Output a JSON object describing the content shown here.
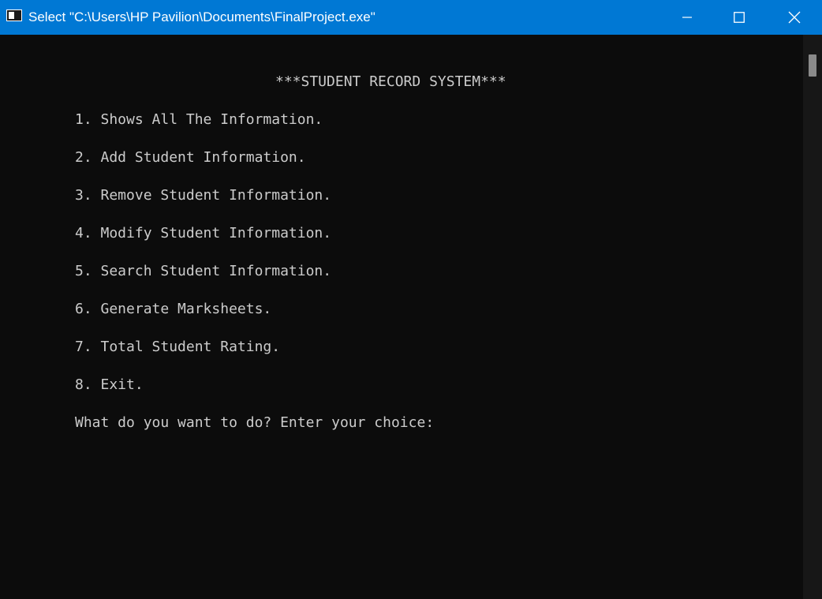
{
  "window": {
    "title": "Select \"C:\\Users\\HP Pavilion\\Documents\\FinalProject.exe\"",
    "controls": {
      "minimize": "minimize-icon",
      "maximize": "maximize-icon",
      "close": "close-icon"
    },
    "titlebar_color": "#0078d4",
    "console_bg": "#0c0c0c",
    "console_fg": "#cccccc"
  },
  "console": {
    "heading": "***STUDENT RECORD SYSTEM***",
    "menu": [
      "1. Shows All The Information.",
      "2. Add Student Information.",
      "3. Remove Student Information.",
      "4. Modify Student Information.",
      "5. Search Student Information.",
      "6. Generate Marksheets.",
      "7. Total Student Rating.",
      "8. Exit."
    ],
    "prompt": "What do you want to do? Enter your choice:"
  }
}
